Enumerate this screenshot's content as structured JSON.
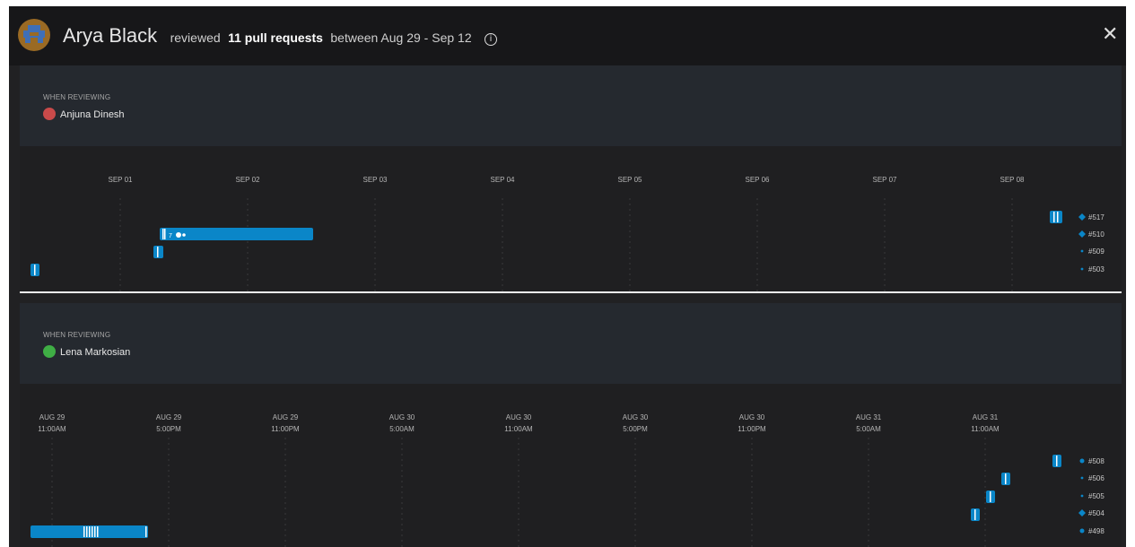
{
  "header": {
    "user_name": "Arya Black",
    "text_before": "reviewed",
    "count_text": "11 pull requests",
    "range_text": "between Aug 29 - Sep 12",
    "info_icon": "info-icon",
    "close_icon": "close-icon"
  },
  "sections": [
    {
      "when_label": "WHEN REVIEWING",
      "person": "Anjuna Dinesh",
      "avatar_color": "#c94a4a",
      "ticks": [
        {
          "line1": "SEP 01",
          "line2": ""
        },
        {
          "line1": "SEP 02",
          "line2": ""
        },
        {
          "line1": "SEP 03",
          "line2": ""
        },
        {
          "line1": "SEP 04",
          "line2": ""
        },
        {
          "line1": "SEP 05",
          "line2": ""
        },
        {
          "line1": "SEP 06",
          "line2": ""
        },
        {
          "line1": "SEP 07",
          "line2": ""
        },
        {
          "line1": "SEP 08",
          "line2": ""
        }
      ],
      "legend": [
        {
          "label": "#517",
          "marker": "large"
        },
        {
          "label": "#510",
          "marker": "large"
        },
        {
          "label": "#509",
          "marker": "small"
        },
        {
          "label": "#503",
          "marker": "small"
        }
      ],
      "bar_label": "7"
    },
    {
      "when_label": "WHEN REVIEWING",
      "person": "Lena Markosian",
      "avatar_color": "#3fae45",
      "ticks": [
        {
          "line1": "AUG 29",
          "line2": "11:00AM"
        },
        {
          "line1": "AUG 29",
          "line2": "5:00PM"
        },
        {
          "line1": "AUG 29",
          "line2": "11:00PM"
        },
        {
          "line1": "AUG 30",
          "line2": "5:00AM"
        },
        {
          "line1": "AUG 30",
          "line2": "11:00AM"
        },
        {
          "line1": "AUG 30",
          "line2": "5:00PM"
        },
        {
          "line1": "AUG 30",
          "line2": "11:00PM"
        },
        {
          "line1": "AUG 31",
          "line2": "5:00AM"
        },
        {
          "line1": "AUG 31",
          "line2": "11:00AM"
        }
      ],
      "legend": [
        {
          "label": "#508",
          "marker": "medium"
        },
        {
          "label": "#506",
          "marker": "small"
        },
        {
          "label": "#505",
          "marker": "small"
        },
        {
          "label": "#504",
          "marker": "large"
        },
        {
          "label": "#498",
          "marker": "medium"
        }
      ],
      "bar_label": ""
    }
  ],
  "colors": {
    "bar": "#0a86c8",
    "tick_mark": "#ffffff",
    "grid": "#3a3a3c"
  }
}
